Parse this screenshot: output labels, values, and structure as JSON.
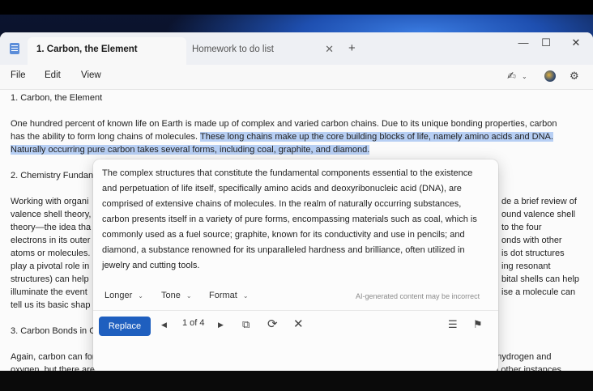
{
  "tabs": {
    "active": "1. Carbon, the Element",
    "inactive": "Homework to do list",
    "close_glyph": "✕",
    "add_glyph": "+"
  },
  "window_controls": {
    "minimize": "—",
    "maximize": "☐",
    "close": "✕"
  },
  "menu": {
    "file": "File",
    "edit": "Edit",
    "view": "View"
  },
  "toolbar": {
    "pen_glyph": "✍",
    "settings_glyph": "⚙"
  },
  "document": {
    "heading1": "1. Carbon, the Element",
    "para1_line1": "One hundred percent of known life on Earth is made up of complex and varied carbon chains. Due to its unique bonding properties, carbon",
    "para1_line2_plain": "has the ability to form long chains of molecules. ",
    "para1_line2_sel": "These long chains make up the core building blocks of life, namely amino acids and DNA.",
    "para1_line3_sel": "Naturally occurring pure carbon takes several forms, including coal, graphite, and diamond.",
    "heading2": "2. Chemistry Fundan",
    "para2_left": [
      "Working with organi",
      "valence shell theory,",
      "theory—the idea tha",
      "electrons in its outer",
      "atoms or molecules.",
      "play a pivotal role in",
      "structures) can help",
      "illuminate the event",
      "tell us its basic shap"
    ],
    "para2_right": [
      "de a brief review of",
      "ound valence shell",
      "to the four",
      "onds with other",
      "is dot structures",
      "ing resonant",
      "bital shells can help",
      "ise a molecule can",
      ""
    ],
    "heading3": "3. Carbon Bonds in C",
    "para3_line1": "Again, carbon can form up to four bonds with other molecules. In organic chemistry, we mainly focus on carbon chains with hydrogen and",
    "para3_line2": "oxygen, but there are infinite possible compounds. In the simplest form, carbon bonds with four hydrogen in single bonds. In other instances"
  },
  "rewrite_popup": {
    "lines": [
      "The complex structures that constitute the fundamental components essential to the existence",
      "and perpetuation of life itself, specifically amino acids and deoxyribonucleic acid (DNA), are",
      "comprised of extensive chains of molecules. In the realm of naturally occurring substances,",
      "carbon presents itself in a variety of pure forms, encompassing materials such as coal, which is",
      "commonly used as a fuel source; graphite, known for its conductivity and use in pencils; and",
      "diamond, a substance renowned for its unparalleled hardness and brilliance, often utilized in",
      "jewelry and cutting tools."
    ],
    "options": {
      "longer": "Longer",
      "tone": "Tone",
      "format": "Format",
      "chevron": "⌄"
    },
    "disclaimer": "AI-generated content may be incorrect",
    "replace": "Replace",
    "prev": "◀",
    "page": "1 of 4",
    "next": "▶",
    "copy_glyph": "⧉",
    "retry_glyph": "⟳",
    "dismiss_glyph": "✕",
    "db_glyph": "☰",
    "flag_glyph": "⚑"
  }
}
